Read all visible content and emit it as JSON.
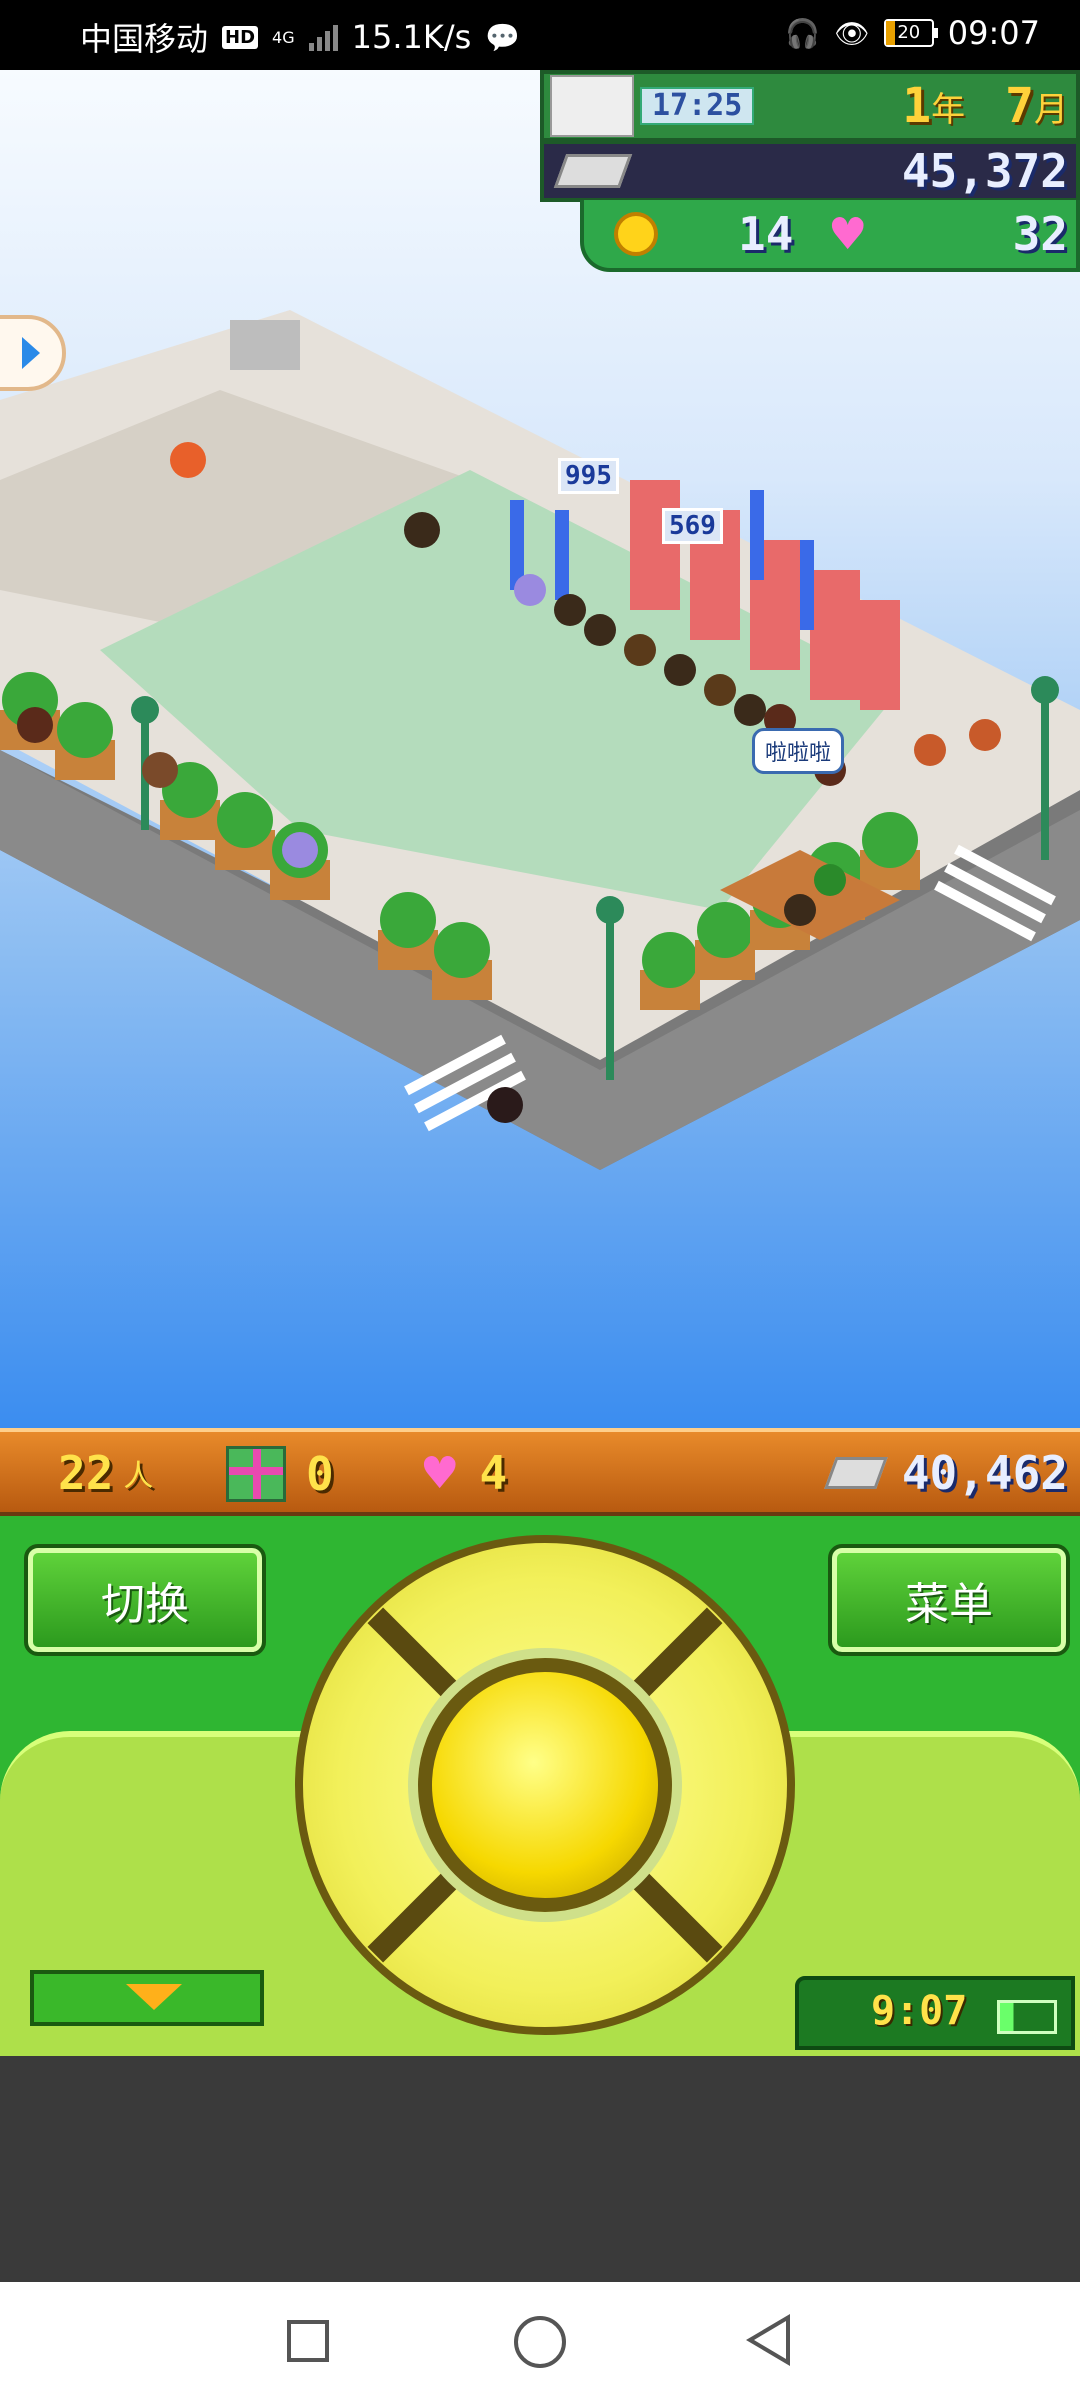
{
  "status_bar": {
    "carrier": "中国移动",
    "hd_badge": "HD",
    "network": "4G",
    "speed": "15.1K/s",
    "battery": "20",
    "time": "09:07"
  },
  "hud": {
    "clock_time": "17:25",
    "year_value": "1",
    "year_unit": "年",
    "month_value": "7",
    "month_unit": "月",
    "money": "45,372",
    "coins": "14",
    "hearts": "32"
  },
  "scene": {
    "speech_bubble": "啦啦啦",
    "booth_values": [
      "995",
      "569"
    ]
  },
  "info_bar": {
    "visitors": "22",
    "visitors_unit": "人",
    "gifts": "0",
    "hearts": "4",
    "tickets": "40,462"
  },
  "controls": {
    "switch_label": "切换",
    "menu_label": "菜单",
    "mini_clock": "9:07",
    "battery_level": 0.25
  },
  "colors": {
    "panel_green": "#2fb632",
    "info_orange": "#e88a2a",
    "dpad_yellow": "#f2f05a"
  }
}
